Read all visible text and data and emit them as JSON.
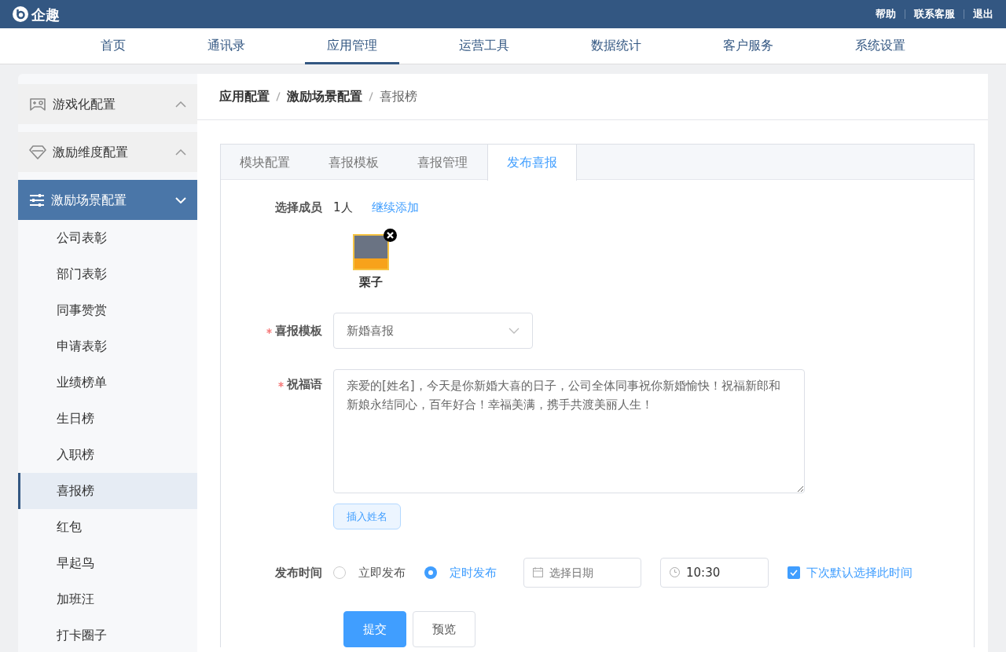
{
  "app": {
    "name": "企趣"
  },
  "top_links": [
    "帮助",
    "联系客服",
    "退出"
  ],
  "nav": [
    {
      "label": "首页",
      "selected": false
    },
    {
      "label": "通讯录",
      "selected": false
    },
    {
      "label": "应用管理",
      "selected": true
    },
    {
      "label": "运营工具",
      "selected": false
    },
    {
      "label": "数据统计",
      "selected": false
    },
    {
      "label": "客户服务",
      "selected": false
    },
    {
      "label": "系统设置",
      "selected": false
    }
  ],
  "sidebar": {
    "groups": [
      {
        "label": "游戏化配置",
        "kind": "gamepad",
        "expanded": false,
        "selected": false
      },
      {
        "label": "激励维度配置",
        "kind": "diamond",
        "expanded": false,
        "selected": false
      },
      {
        "label": "激励场景配置",
        "kind": "sliders",
        "expanded": true,
        "selected": true,
        "children": [
          {
            "label": "公司表彰",
            "selected": false
          },
          {
            "label": "部门表彰",
            "selected": false
          },
          {
            "label": "同事赞赏",
            "selected": false
          },
          {
            "label": "申请表彰",
            "selected": false
          },
          {
            "label": "业绩榜单",
            "selected": false
          },
          {
            "label": "生日榜",
            "selected": false
          },
          {
            "label": "入职榜",
            "selected": false
          },
          {
            "label": "喜报榜",
            "selected": true
          },
          {
            "label": "红包",
            "selected": false
          },
          {
            "label": "早起鸟",
            "selected": false
          },
          {
            "label": "加班汪",
            "selected": false
          },
          {
            "label": "打卡圈子",
            "selected": false
          }
        ]
      }
    ]
  },
  "breadcrumb": [
    "应用配置",
    "激励场景配置",
    "喜报榜"
  ],
  "tabs": [
    {
      "label": "模块配置",
      "selected": false
    },
    {
      "label": "喜报模板",
      "selected": false
    },
    {
      "label": "喜报管理",
      "selected": false
    },
    {
      "label": "发布喜报",
      "selected": true
    }
  ],
  "form": {
    "members": {
      "label": "选择成员",
      "count": "1人",
      "add_link": "继续添加",
      "people": [
        {
          "name": "栗子"
        }
      ]
    },
    "template": {
      "label": "喜报模板",
      "required": true,
      "value": "新婚喜报"
    },
    "greeting": {
      "label": "祝福语",
      "required": true,
      "value": "亲爱的[姓名]，今天是你新婚大喜的日子，公司全体同事祝你新婚愉快！祝福新郎和新娘永结同心，百年好合！幸福美满，携手共渡美丽人生！",
      "insert_button": "插入姓名"
    },
    "publish_time": {
      "label": "发布时间",
      "options": [
        {
          "label": "立即发布",
          "selected": false
        },
        {
          "label": "定时发布",
          "selected": true
        }
      ],
      "date": {
        "placeholder": "选择日期"
      },
      "time": {
        "value": "10:30"
      },
      "remember": {
        "label": "下次默认选择此时间",
        "checked": true
      }
    },
    "buttons": [
      {
        "label": "提交",
        "kind": "primary"
      },
      {
        "label": "预览",
        "kind": "default"
      }
    ]
  }
}
